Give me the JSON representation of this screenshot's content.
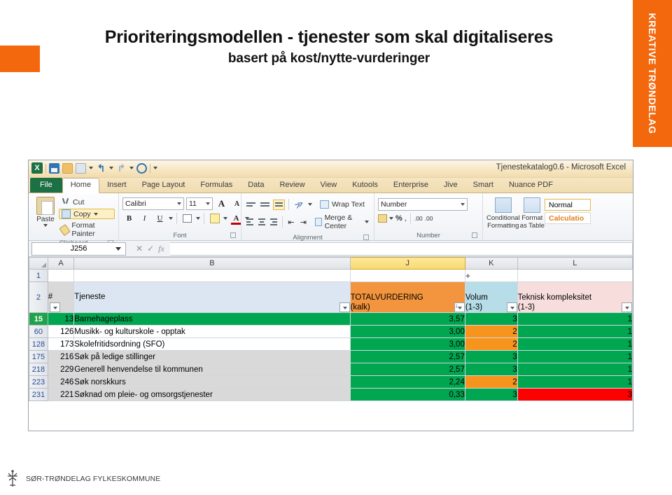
{
  "slide": {
    "title_line1": "Prioriteringsmodellen - tjenester som skal digitaliseres",
    "title_line2": "basert på kost/nytte-vurderinger",
    "brand_vertical": "KREATIVE TRØNDELAG",
    "footer_org": "SØR-TRØNDELAG FYLKESKOMMUNE",
    "accent_color": "#f4680d"
  },
  "excel": {
    "window_title": "Tjenestekatalog0.6  -  Microsoft Excel",
    "quick_access": [
      {
        "name": "excel-logo",
        "label": "X"
      },
      {
        "name": "save-icon",
        "label": ""
      },
      {
        "name": "open-icon",
        "label": ""
      },
      {
        "name": "print-icon",
        "label": ""
      },
      {
        "name": "undo-icon",
        "label": "↰"
      },
      {
        "name": "redo-icon",
        "label": "↱"
      },
      {
        "name": "print-preview-icon",
        "label": ""
      },
      {
        "name": "customize-qat-icon",
        "label": ""
      }
    ],
    "tabs": [
      {
        "label": "File",
        "state": "file"
      },
      {
        "label": "Home",
        "state": "active"
      },
      {
        "label": "Insert",
        "state": ""
      },
      {
        "label": "Page Layout",
        "state": ""
      },
      {
        "label": "Formulas",
        "state": ""
      },
      {
        "label": "Data",
        "state": ""
      },
      {
        "label": "Review",
        "state": ""
      },
      {
        "label": "View",
        "state": ""
      },
      {
        "label": "Kutools",
        "state": ""
      },
      {
        "label": "Enterprise",
        "state": ""
      },
      {
        "label": "Jive",
        "state": ""
      },
      {
        "label": "Smart",
        "state": ""
      },
      {
        "label": "Nuance PDF",
        "state": ""
      }
    ],
    "ribbon": {
      "clipboard": {
        "group_label": "Clipboard",
        "paste": "Paste",
        "cut": "Cut",
        "copy": "Copy",
        "format_painter": "Format Painter"
      },
      "font": {
        "group_label": "Font",
        "font_family": "Calibri",
        "font_size": "11",
        "grow_font": "A",
        "shrink_font": "A",
        "bold": "B",
        "italic": "I",
        "underline": "U",
        "borders": "",
        "fill_color": "",
        "font_color": "A"
      },
      "alignment": {
        "group_label": "Alignment",
        "wrap_text": "Wrap Text",
        "merge_center": "Merge & Center"
      },
      "number": {
        "group_label": "Number",
        "format": "Number",
        "accounting": "",
        "percent": "%",
        "comma": ",",
        "increase_decimal": ".00",
        "decrease_decimal": ".00"
      },
      "styles": {
        "conditional_formatting": "Conditional Formatting",
        "format_as_table": "Format as Table",
        "style_normal": "Normal",
        "style_calculation": "Calculatio"
      }
    },
    "formula_bar": {
      "name_box": "J256",
      "formula_value": "",
      "fx_label": "fx"
    },
    "sheet": {
      "column_letters": [
        "A",
        "B",
        "J",
        "K",
        "L"
      ],
      "selected_column": "J",
      "row1_marker": "+",
      "header_row_number": "2",
      "headers": [
        {
          "col": "A",
          "text": "#",
          "filter": true
        },
        {
          "col": "B",
          "text": "Tjeneste",
          "filter": true
        },
        {
          "col": "J",
          "line1": "TOTALVURDERING",
          "line2": "(kalk)",
          "filter": true,
          "sorted": true
        },
        {
          "col": "K",
          "line1": "Volum",
          "line2": "(1-3)",
          "filter": true
        },
        {
          "col": "L",
          "line1": "Teknisk kompleksitet",
          "line2": "(1-3)",
          "filter": true
        }
      ],
      "rows": [
        {
          "row": "15",
          "row_selected": true,
          "id": "13",
          "tjeneste": "Barnehageplass",
          "total": "3,57",
          "volum": "3",
          "comp": "1",
          "ab_fill": "green",
          "total_fill": "green",
          "volum_fill": "green",
          "comp_fill": "green"
        },
        {
          "row": "60",
          "row_selected": false,
          "id": "126",
          "tjeneste": "Musikk- og kulturskole - opptak",
          "total": "3,00",
          "volum": "2",
          "comp": "1",
          "ab_fill": "white",
          "total_fill": "green",
          "volum_fill": "orange",
          "comp_fill": "green"
        },
        {
          "row": "128",
          "row_selected": false,
          "id": "173",
          "tjeneste": "Skolefritidsordning (SFO)",
          "total": "3,00",
          "volum": "2",
          "comp": "1",
          "ab_fill": "white",
          "total_fill": "green",
          "volum_fill": "orange",
          "comp_fill": "green"
        },
        {
          "row": "175",
          "row_selected": false,
          "id": "216",
          "tjeneste": "Søk på ledige stillinger",
          "total": "2,57",
          "volum": "3",
          "comp": "1",
          "ab_fill": "gray",
          "total_fill": "green",
          "volum_fill": "green",
          "comp_fill": "green"
        },
        {
          "row": "218",
          "row_selected": false,
          "id": "229",
          "tjeneste": "Generell henvendelse til kommunen",
          "total": "2,57",
          "volum": "3",
          "comp": "1",
          "ab_fill": "gray",
          "total_fill": "green",
          "volum_fill": "green",
          "comp_fill": "green"
        },
        {
          "row": "223",
          "row_selected": false,
          "id": "246",
          "tjeneste": "Søk norskkurs",
          "total": "2,24",
          "volum": "2",
          "comp": "1",
          "ab_fill": "gray",
          "total_fill": "green",
          "volum_fill": "orange",
          "comp_fill": "green"
        },
        {
          "row": "231",
          "row_selected": false,
          "id": "221",
          "tjeneste": "Søknad om pleie- og omsorgstjenester",
          "total": "0,33",
          "volum": "3",
          "comp": "3",
          "ab_fill": "gray",
          "total_fill": "green",
          "volum_fill": "green",
          "comp_fill": "red"
        }
      ]
    }
  }
}
